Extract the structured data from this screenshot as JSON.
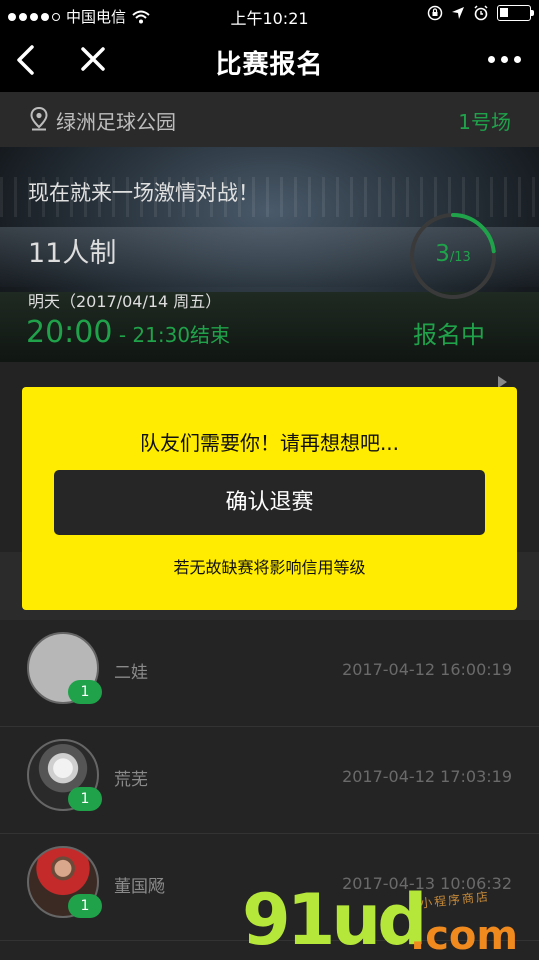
{
  "status_bar": {
    "carrier": "中国电信",
    "time": "上午10:21"
  },
  "nav": {
    "title": "比赛报名",
    "back_icon": "chevron-left-icon",
    "close_icon": "close-icon",
    "more_icon": "more-dots-icon"
  },
  "venue": {
    "name": "绿洲足球公园",
    "field": "1号场",
    "icon": "location-pin-icon"
  },
  "match": {
    "slogan": "现在就来一场激情对战！",
    "format": "11人制",
    "date": "明天（2017/04/14 周五）",
    "start_time": "20:00",
    "end_time": " - 21:30结束",
    "registered": "3",
    "capacity": "/13",
    "registered_fraction": 0.2308,
    "status": "报名中"
  },
  "modal": {
    "message": "队友们需要你！请再想想吧...",
    "confirm_label": "确认退赛",
    "warning": "若无故缺赛将影响信用等级"
  },
  "players": [
    {
      "name": "二娃",
      "timestamp": "2017-04-12 16:00:19",
      "count": "1"
    },
    {
      "name": "荒芜",
      "timestamp": "2017-04-12 17:03:19",
      "count": "1"
    },
    {
      "name": "董国飏",
      "timestamp": "2017-04-13 10:06:32",
      "count": "1"
    }
  ],
  "watermark": {
    "brand": "91ud",
    "suffix": ".com",
    "tagline": "小程序商店"
  },
  "colors": {
    "accent_green": "#1fa24a",
    "modal_yellow": "#ffec00",
    "dark_button": "#262626"
  }
}
